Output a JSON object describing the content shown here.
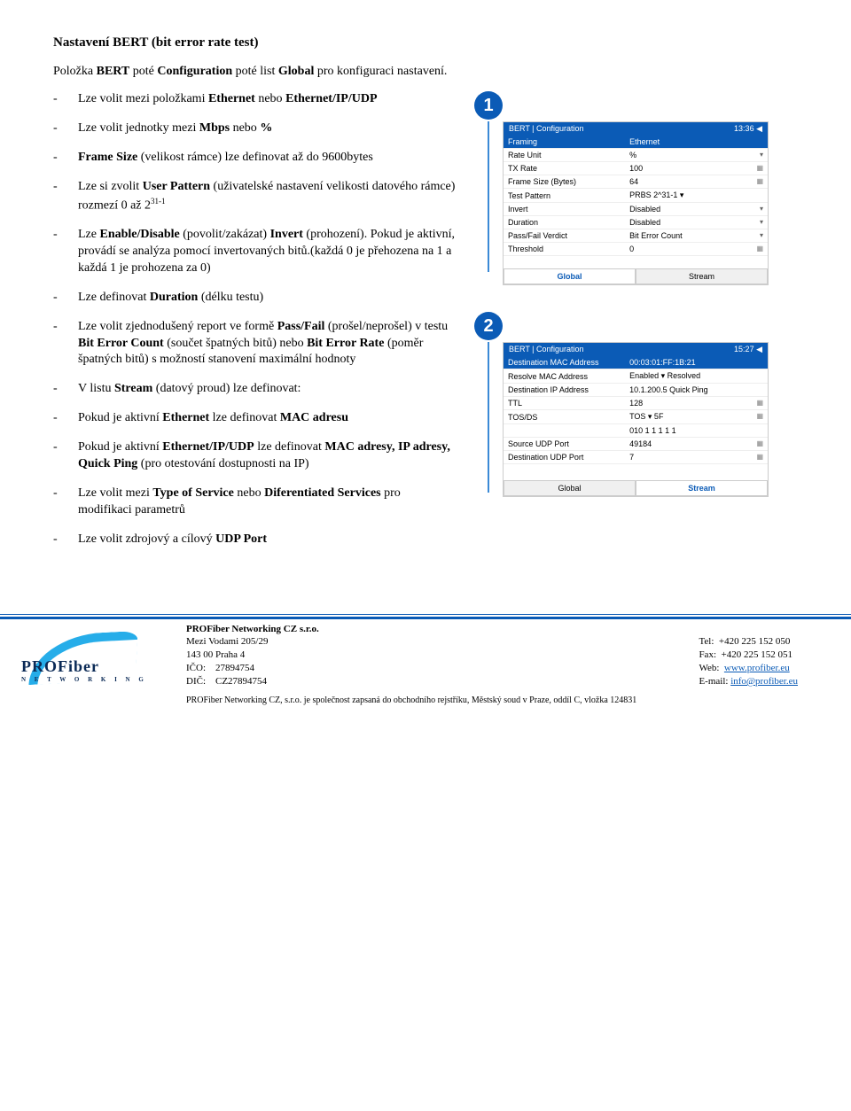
{
  "title": "Nastavení BERT (bit error rate test)",
  "intro_pre": "Položka ",
  "intro_b1": "BERT",
  "intro_mid1": " poté ",
  "intro_b2": "Configuration",
  "intro_mid2": " poté list ",
  "intro_b3": "Global",
  "intro_post": " pro konfiguraci nastavení.",
  "bullets": [
    {
      "pre": "Lze volit mezi položkami ",
      "b": "Ethernet",
      "post": "  nebo ",
      "b2": "Ethernet/IP/UDP",
      "post2": ""
    },
    {
      "pre": "Lze volit jednotky mezi ",
      "b": "Mbps",
      "post": " nebo ",
      "b2": "%",
      "post2": ""
    },
    {
      "b": "Frame Size",
      "pre2": " (velikost rámce) lze definovat až do 9600bytes"
    },
    {
      "pre": "Lze si zvolit ",
      "b": "User Pattern",
      "post": " (uživatelské nastavení velikosti datového rámce) rozmezí 0 až 2",
      "sup": "31-1"
    },
    {
      "pre": "Lze ",
      "b": "Enable/Disable",
      "post": " (povolit/zakázat) ",
      "b2": "Invert",
      "post2": " (prohození). Pokud je aktivní, provádí se analýza pomocí invertovaných bitů.(každá 0 je přehozena na 1 a každá 1 je prohozena za 0)"
    },
    {
      "pre": "Lze definovat ",
      "b": "Duration",
      "post": " (délku testu)"
    },
    {
      "pre": "Lze volit zjednodušený report ve formě ",
      "b": "Pass/Fail",
      "post": " (prošel/neprošel) v testu ",
      "b2": "Bit Error Count",
      "post2": " (součet špatných bitů) nebo ",
      "b3": "Bit Error Rate",
      "post3": " (poměr špatných bitů) s možností stanovení maximální hodnoty"
    },
    {
      "pre": "V listu ",
      "b": "Stream",
      "post": " (datový proud) lze definovat:"
    },
    {
      "pre": "Pokud je aktivní ",
      "b": "Ethernet",
      "post": " lze definovat ",
      "b2": "MAC adresu",
      "post2": ""
    },
    {
      "pre": "Pokud je aktivní ",
      "b": "Ethernet/IP/UDP",
      "post": " lze definovat ",
      "b2": "MAC adresy, IP adresy, Quick Ping",
      "post2": " (pro otestování dostupnosti na IP)"
    },
    {
      "pre": "Lze volit mezi ",
      "b": "Type of Service",
      "post": " nebo ",
      "b2": "Diferentiated Services",
      "post2": " pro modifikaci parametrů"
    },
    {
      "pre": "Lze volit zdrojový a cílový ",
      "b": "UDP Port",
      "post": ""
    }
  ],
  "callouts": {
    "1": {
      "num": "1"
    },
    "2": {
      "num": "2"
    }
  },
  "shot1": {
    "hdr_left": "BERT | Configuration",
    "hdr_right": "13:36  ◀",
    "rows": [
      {
        "l": "Framing",
        "r": "Ethernet",
        "hl": true
      },
      {
        "l": "Rate Unit",
        "r": "%"
      },
      {
        "l": "TX Rate",
        "r": "100"
      },
      {
        "l": "Frame Size (Bytes)",
        "r": "64"
      },
      {
        "l": "Test Pattern",
        "r": "PRBS 2^31-1   ▾"
      },
      {
        "l": "Invert",
        "r": "Disabled"
      },
      {
        "l": "Duration",
        "r": "Disabled"
      },
      {
        "l": "Pass/Fail Verdict",
        "r": "Bit Error Count"
      },
      {
        "l": "Threshold",
        "r": "0"
      }
    ],
    "tab_global": "Global",
    "tab_stream": "Stream"
  },
  "shot2": {
    "hdr_left": "BERT | Configuration",
    "hdr_right": "15:27  ◀",
    "rows": [
      {
        "l": "Destination MAC Address",
        "r": "00:03:01:FF:1B:21",
        "hl": true
      },
      {
        "l": "Resolve MAC Address",
        "r": "Enabled        ▾  Resolved"
      },
      {
        "l": "Destination IP Address",
        "r": "10.1.200.5        Quick Ping"
      },
      {
        "l": "TTL",
        "r": "128"
      },
      {
        "l": "TOS/DS",
        "r": "TOS      ▾   5F"
      },
      {
        "l": "",
        "r": "010 1 1 1 1 1"
      },
      {
        "l": "Source UDP Port",
        "r": "49184"
      },
      {
        "l": "Destination UDP Port",
        "r": "7"
      }
    ],
    "tab_global": "Global",
    "tab_stream": "Stream"
  },
  "footer": {
    "company": "PROFiber Networking CZ  s.r.o.",
    "addr1": "Mezi Vodami 205/29",
    "addr2": "143 00 Praha 4",
    "ico_l": "IČO:",
    "ico_v": "27894754",
    "dic_l": "DIČ:",
    "dic_v": "CZ27894754",
    "tel_l": "Tel:",
    "tel_v": "+420 225 152 050",
    "fax_l": "Fax:",
    "fax_v": "+420 225 152 051",
    "web_l": "Web:",
    "web_v": "www.profiber.eu",
    "mail_l": "E-mail:",
    "mail_v": "info@profiber.eu",
    "bottom": "PROFiber Networking CZ, s.r.o. je společnost zapsaná do obchodního rejstříku, Městský soud v Praze, oddíl C, vložka 124831",
    "logo_big": "PROFiber",
    "logo_small": "N E T W O R K I N G"
  }
}
